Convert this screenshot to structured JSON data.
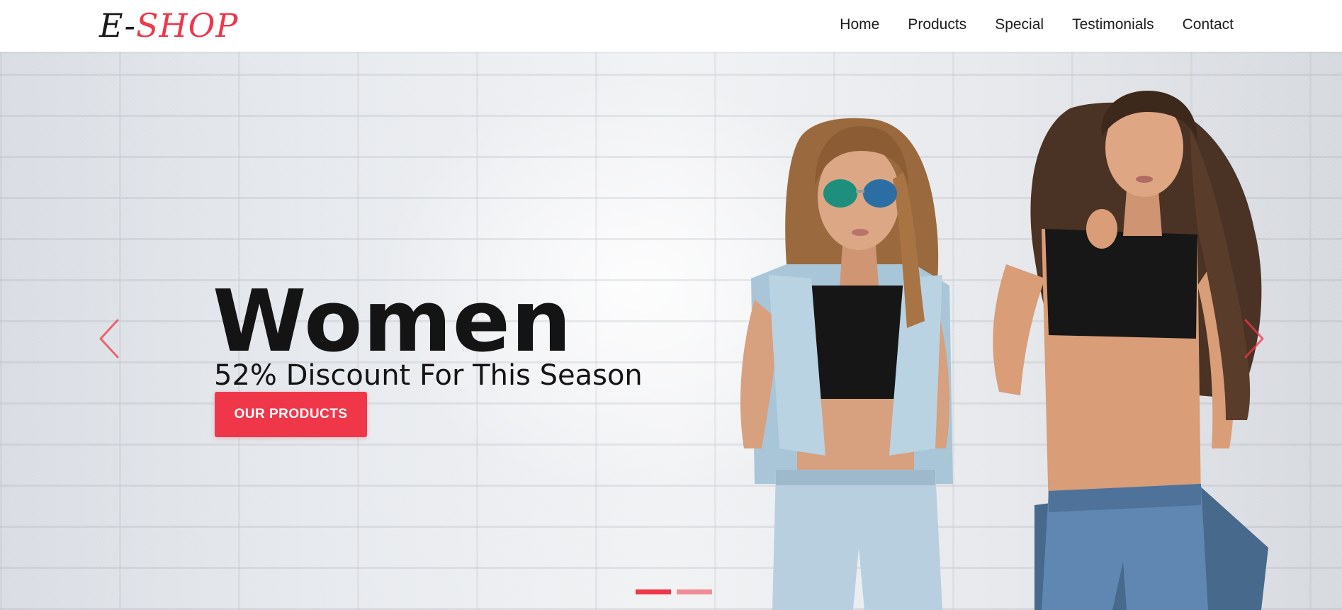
{
  "brand": {
    "logo_prefix": "E-",
    "logo_e": "E",
    "logo_dash": "-",
    "logo_shop": "SHOP",
    "accent_color": "#f0374a"
  },
  "nav": {
    "items": [
      {
        "label": "Home"
      },
      {
        "label": "Products"
      },
      {
        "label": "Special"
      },
      {
        "label": "Testimonials"
      },
      {
        "label": "Contact"
      }
    ]
  },
  "hero": {
    "title": "Women",
    "subtitle": "52% Discount For This Season",
    "cta_label": "OUR PRODUCTS",
    "prev_icon": "chevron-left-icon",
    "next_icon": "chevron-right-icon",
    "slides_total": 2,
    "active_slide": 1,
    "image_description": "two models leaning against a white brick wall"
  }
}
